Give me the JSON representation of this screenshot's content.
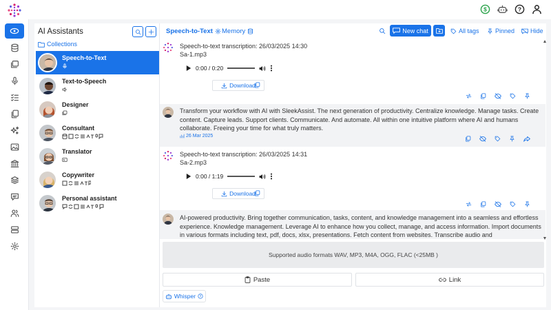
{
  "colors": {
    "accent": "#1a73e8",
    "status_green": "#2aa34a"
  },
  "topbar": {
    "icons": [
      "dollar-icon",
      "robot-icon",
      "help-icon",
      "user-icon"
    ]
  },
  "rail": {
    "items": [
      "chat-icon",
      "database-icon",
      "gallery-icon",
      "microphone-icon",
      "tasks-icon",
      "documents-icon",
      "sparkle-icon",
      "image-icon",
      "institution-icon",
      "server-stack-icon",
      "messages-icon",
      "users-icon",
      "storage-icon",
      "settings-icon"
    ]
  },
  "assistants": {
    "title": "AI Assistants",
    "collections_label": "Collections",
    "items": [
      {
        "name": "Speech-to-Text"
      },
      {
        "name": "Text-to-Speech"
      },
      {
        "name": "Designer"
      },
      {
        "name": "Consultant"
      },
      {
        "name": "Translator"
      },
      {
        "name": "Copywriter"
      },
      {
        "name": "Personal assistant"
      }
    ]
  },
  "chat": {
    "tab_active": "Speech-to-Text",
    "tab_memory": "Memory",
    "new_chat_label": "New chat",
    "all_tags_label": "All tags",
    "pinned_label": "Pinned",
    "hide_label": "Hide",
    "messages": [
      {
        "title": "Speech-to-text transcription: 26/03/2025 14:30",
        "file": "Sa-1.mp3",
        "time": "0:00 / 0:20",
        "download_label": "Download"
      },
      {
        "text": "Transform your workflow with AI with SleekAssist. The next generation of productivity. Centralize knowledge. Manage tasks. Create content. Capture leads. Support clients. Communicate. And automate. All within one intuitive platform where AI and humans collaborate. Freeing your time for what truly matters.",
        "date": "26 Mar 2025"
      },
      {
        "title": "Speech-to-text transcription: 26/03/2025 14:31",
        "file": "Sa-2.mp3",
        "time": "0:00 / 1:19",
        "download_label": "Download"
      },
      {
        "text": "AI-powered productivity. Bring together communication, tasks, content, and knowledge management into a seamless and effortless experience. Knowledge management. Leverage AI to enhance how you collect, manage, and access information. Import documents in various formats including text, pdf, docs, xlsx, presentations. Fetch content from websites. Transcribe audio and"
      }
    ],
    "drop_text": "Supported audio formats WAV, MP3, M4A, OGG, FLAC (<25MB )",
    "paste_label": "Paste",
    "link_label": "Link",
    "whisper_label": "Whisper"
  }
}
